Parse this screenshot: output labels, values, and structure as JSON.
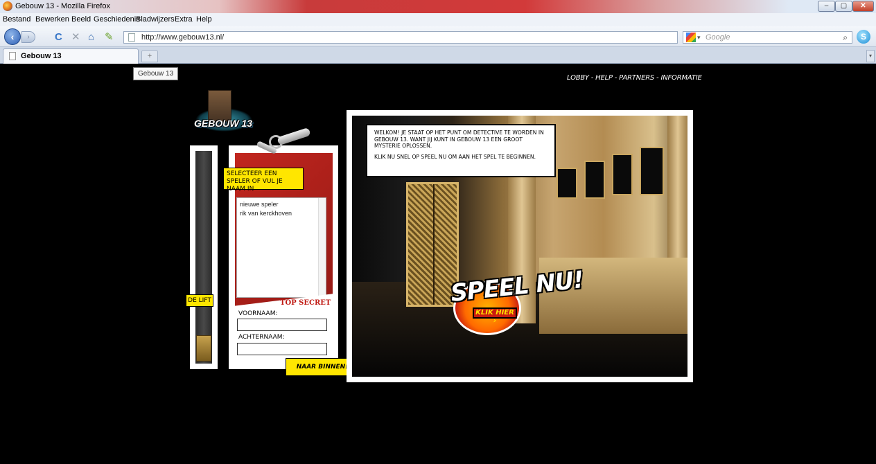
{
  "window": {
    "title": "Gebouw 13 - Mozilla Firefox",
    "min": "–",
    "max": "▢",
    "close": "✕"
  },
  "menu": {
    "items": [
      "Bestand",
      "Bewerken",
      "Beeld",
      "Geschiedenis",
      "Bladwijzers",
      "Extra",
      "Help"
    ]
  },
  "toolbar": {
    "url": "http://www.gebouw13.nl/",
    "search_placeholder": "Google",
    "back": "‹",
    "forward": "›",
    "reload": "C",
    "stop": "✕",
    "home": "⌂",
    "bookmark": "✎",
    "star": "☆",
    "dropdown": "▾",
    "search_go": "⌕",
    "skype": "S"
  },
  "tabs": {
    "active_label": "Gebouw 13",
    "new_tab": "+",
    "list": "▾"
  },
  "tooltip": "Gebouw 13",
  "site": {
    "logo_text": "GEBOUW 13",
    "topnav": "LOBBY - HELP - PARTNERS - INFORMATIE",
    "lift_label": "DE LIFT",
    "select_label": "SELECTEER EEN SPELER OF VUL JE NAAM IN",
    "players": [
      "nieuwe speler",
      "rik van kerckhoven"
    ],
    "top_secret": "TOP SECRET",
    "voornaam_label": "VOORNAAM:",
    "achternaam_label": "ACHTERNAAM:",
    "enter_button": "NAAR BINNEN!",
    "welcome_p1": "WELKOM! JE STAAT OP HET PUNT OM DETECTIVE TE WORDEN IN GEBOUW 13. WANT JIJ KUNT IN GEBOUW 13 EEN GROOT MYSTERIE OPLOSSEN.",
    "welcome_p2": "KLIK NU SNEL OP SPEEL NU OM AAN HET SPEL TE BEGINNEN.",
    "play_big": "SPEEL NU!",
    "play_small": "KLIK HIER ›"
  }
}
